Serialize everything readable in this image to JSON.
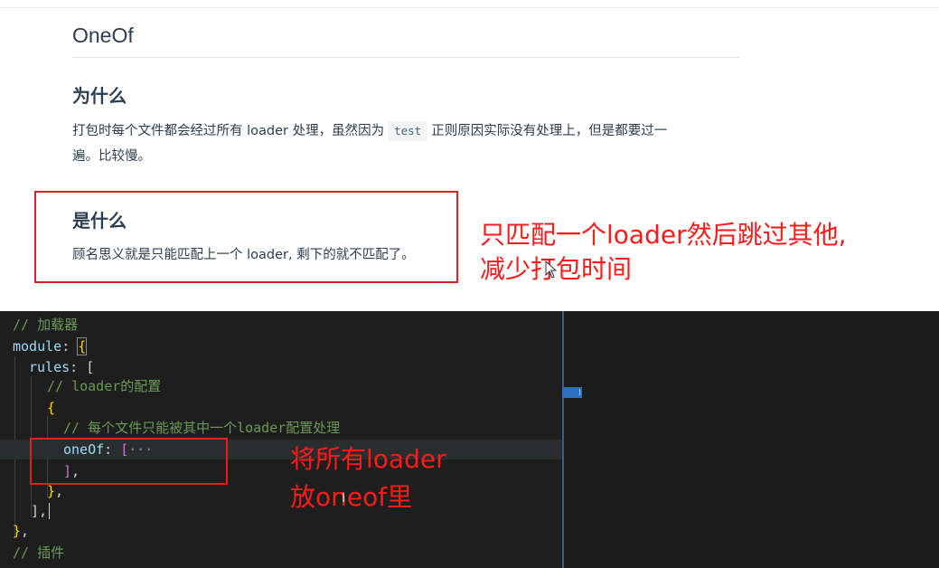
{
  "doc": {
    "title": "OneOf",
    "why": {
      "heading": "为什么",
      "text_before": "打包时每个文件都会经过所有 loader 处理，虽然因为",
      "code": "test",
      "text_after": "正则原因实际没有处理上，但是都要过一",
      "text_line2": "遍。比较慢。"
    },
    "what": {
      "heading": "是什么",
      "text": "顾名思义就是只能匹配上一个 loader, 剩下的就不匹配了。"
    }
  },
  "annotations": {
    "top_line1": "只匹配一个loader然后跳过其他,",
    "top_line2": "减少打包时间",
    "bottom_line1": "将所有loader",
    "bottom_line2": "放oneof里"
  },
  "editor": {
    "lines": [
      {
        "tokens": [
          "// 加载器"
        ]
      },
      {
        "tokens": [
          "module",
          ": ",
          "{"
        ]
      },
      {
        "tokens": [
          "rules",
          ": ",
          "["
        ]
      },
      {
        "tokens": [
          "// loader的配置"
        ]
      },
      {
        "tokens": [
          "{"
        ]
      },
      {
        "tokens": [
          "// 每个文件只能被其中一个loader配置处理"
        ]
      },
      {
        "tokens": [
          "oneOf",
          ": ",
          "[",
          "···"
        ]
      },
      {
        "tokens": [
          "]",
          ","
        ]
      },
      {
        "tokens": [
          "}",
          ","
        ]
      },
      {
        "tokens": [
          "]",
          ","
        ]
      },
      {
        "tokens": [
          "}",
          ","
        ]
      },
      {
        "tokens": [
          "// 插件"
        ]
      }
    ]
  },
  "colors": {
    "annotation_red": "#ff1a1a",
    "editor_bg": "#1e1e1e",
    "comment": "#6a9955",
    "property": "#9cdcfe"
  }
}
